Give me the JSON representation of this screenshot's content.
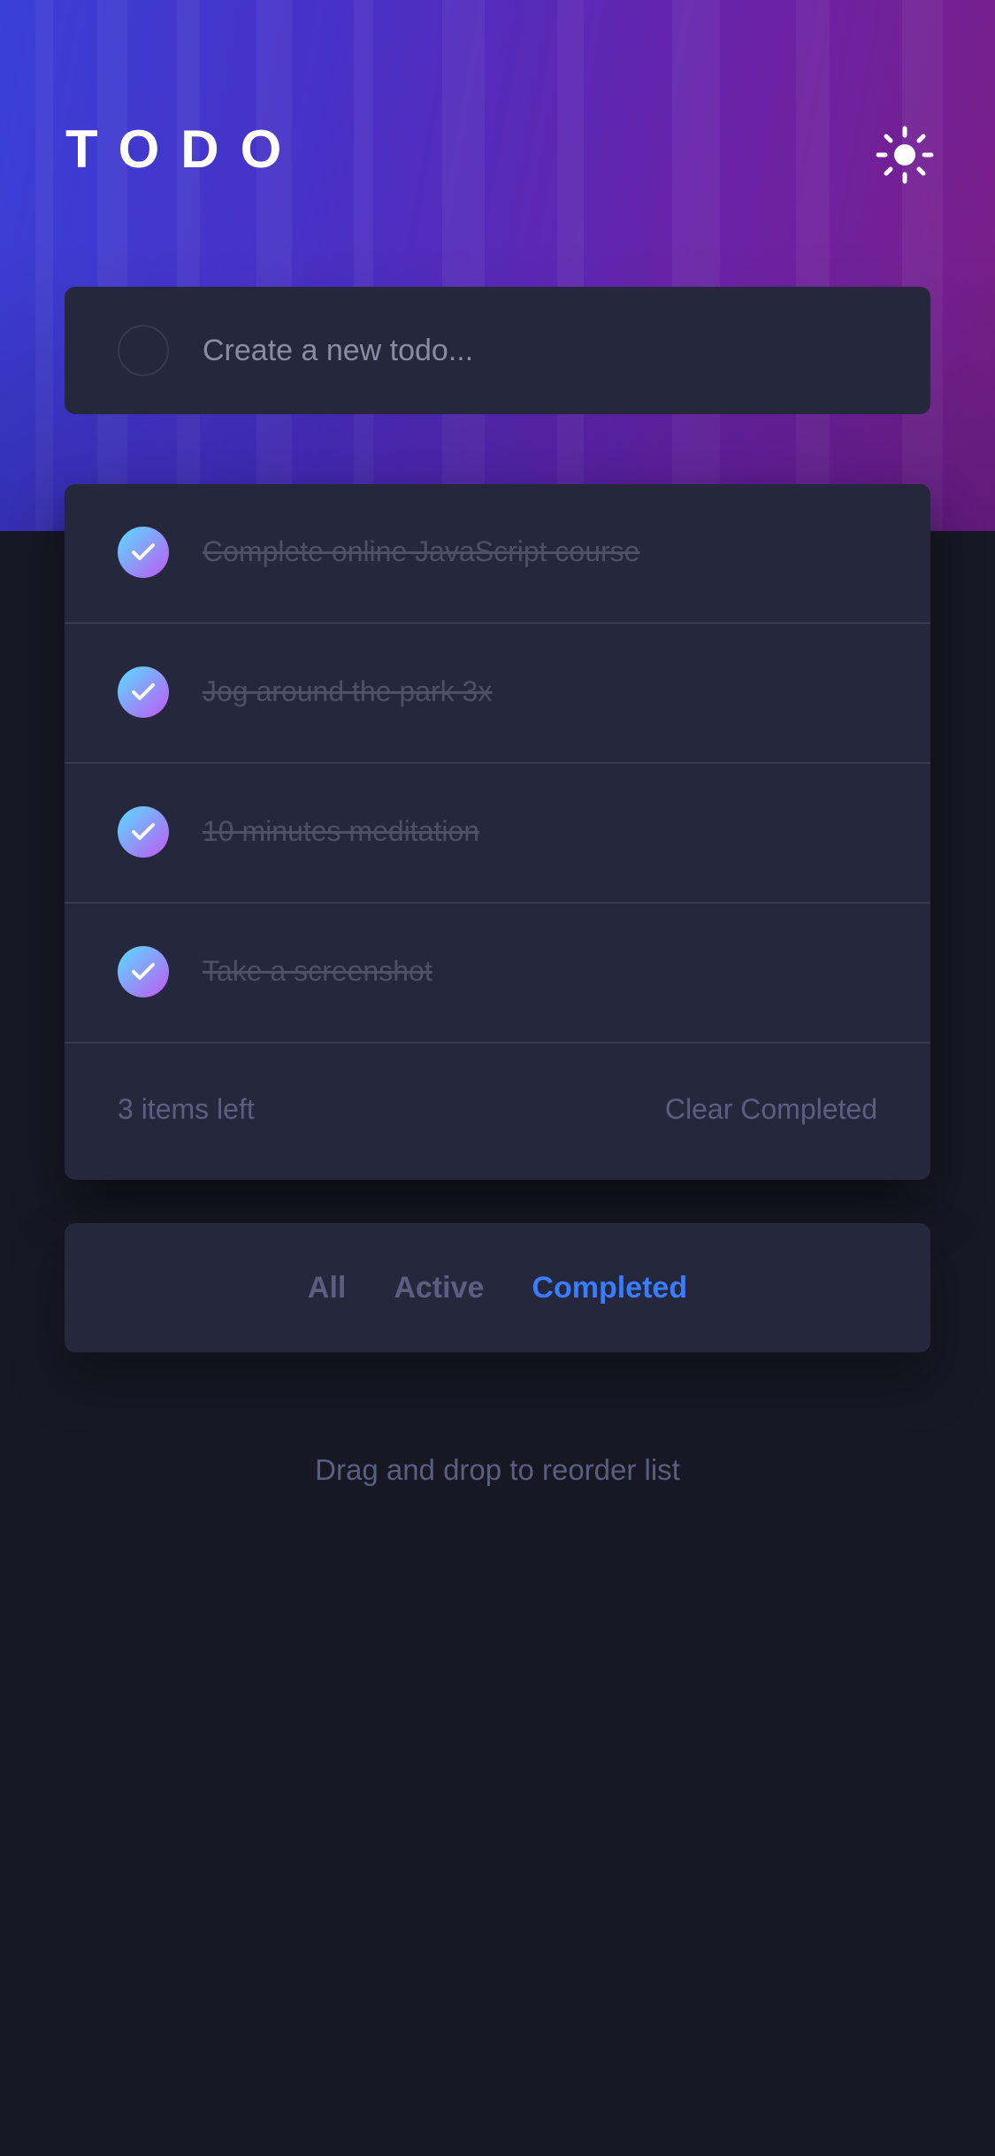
{
  "header": {
    "title": "TODO",
    "theme_icon": "sun-icon"
  },
  "new_todo": {
    "placeholder": "Create a new todo..."
  },
  "todos": [
    {
      "text": "Complete online JavaScript course",
      "completed": true
    },
    {
      "text": "Jog around the park 3x",
      "completed": true
    },
    {
      "text": "10 minutes meditation",
      "completed": true
    },
    {
      "text": "Take a screenshot",
      "completed": true
    }
  ],
  "footer": {
    "items_left": "3 items left",
    "clear_label": "Clear Completed"
  },
  "filters": {
    "all": "All",
    "active": "Active",
    "completed": "Completed",
    "selected": "completed"
  },
  "hint": "Drag and drop to reorder list",
  "colors": {
    "accent": "#3a7cfd",
    "card": "#25273c",
    "background": "#171824",
    "check_gradient_start": "#57ddff",
    "check_gradient_end": "#c058f3"
  }
}
